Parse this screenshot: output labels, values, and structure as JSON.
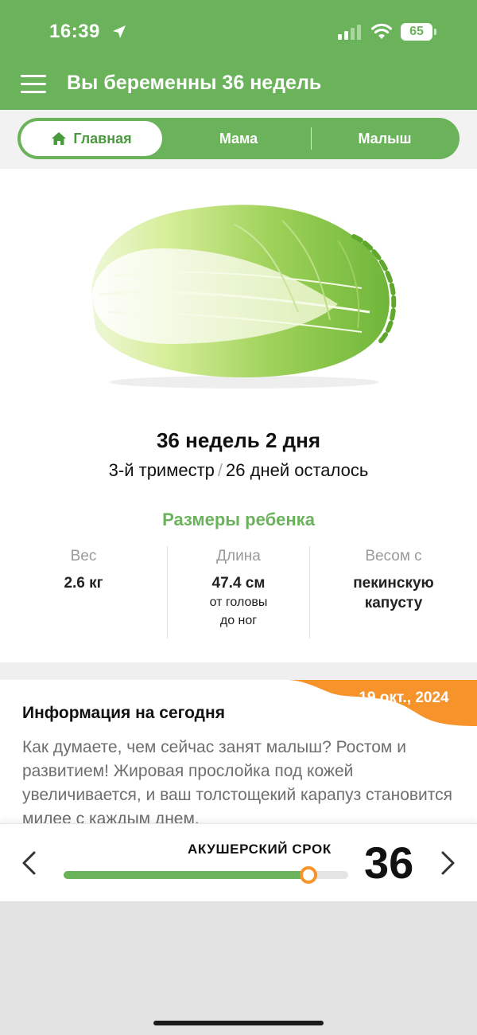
{
  "status_bar": {
    "time": "16:39",
    "battery": "65",
    "icons": [
      "location-arrow-icon",
      "signal-icon",
      "wifi-icon",
      "battery-icon"
    ]
  },
  "header": {
    "title": "Вы беременны 36 недель",
    "menu_icon": "hamburger-menu-icon"
  },
  "colors": {
    "brand_green": "#6ab35b",
    "accent_orange": "#f7932b"
  },
  "tabs": [
    {
      "label": "Главная",
      "icon": "home-icon",
      "active": true
    },
    {
      "label": "Мама",
      "active": false
    },
    {
      "label": "Малыш",
      "active": false
    }
  ],
  "main": {
    "image": "napa-cabbage",
    "week_title": "36 недель 2 дня",
    "trimester": "3-й триместр",
    "separator": "/",
    "days_left": "26 дней осталось",
    "sizes_title": "Размеры ребенка",
    "weight": {
      "label": "Вес",
      "value": "2.6 кг"
    },
    "length": {
      "label": "Длина",
      "value": "47.4 см",
      "note_1": "от головы",
      "note_2": "до ног"
    },
    "comparison": {
      "label": "Весом с",
      "value_1": "пекинскую",
      "value_2": "капусту"
    }
  },
  "info": {
    "date": "19 окт., 2024",
    "title": "Информация на сегодня",
    "text": "Как думаете, чем сейчас занят малыш? Ростом и развитием! Жировая прослойка под кожей увеличивается, и ваш толстощекий карапуз становится милее с каждым днем."
  },
  "bottom": {
    "label": "АКУШЕРСКИЙ СРОК",
    "week_number": "36",
    "progress_fraction": 0.86
  }
}
